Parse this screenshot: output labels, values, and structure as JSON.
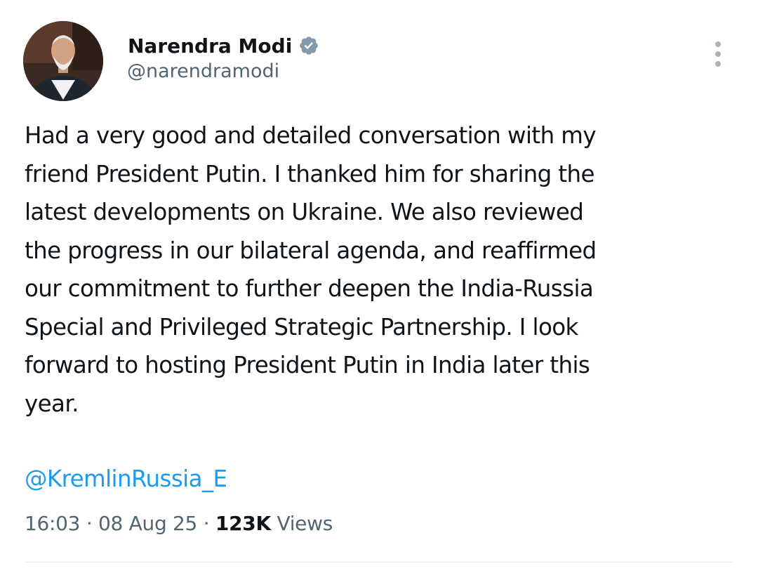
{
  "author": {
    "display_name": "Narendra Modi",
    "handle": "@narendramodi",
    "verified_icon": "verified-badge-icon",
    "avatar_icon": "profile-photo"
  },
  "more_menu": {
    "icon": "more-vertical-icon"
  },
  "tweet": {
    "text": "Had a very good and detailed conversation with my\nfriend President Putin. I thanked him for sharing the\nlatest developments on Ukraine. We also reviewed\nthe progress in our bilateral agenda, and reaffirmed\nour commitment to further deepen the India-Russia\nSpecial and Privileged Strategic Partnership. I look\nforward to hosting President Putin in India later this\nyear.",
    "mention": "@KremlinRussia_E"
  },
  "meta": {
    "time": "16:03",
    "separator": "·",
    "date": "08 Aug 25",
    "views_count": "123K",
    "views_label": "Views"
  },
  "colors": {
    "text": "#0f1419",
    "secondary": "#536471",
    "link": "#1d9bf0",
    "verified": "#829aab"
  }
}
